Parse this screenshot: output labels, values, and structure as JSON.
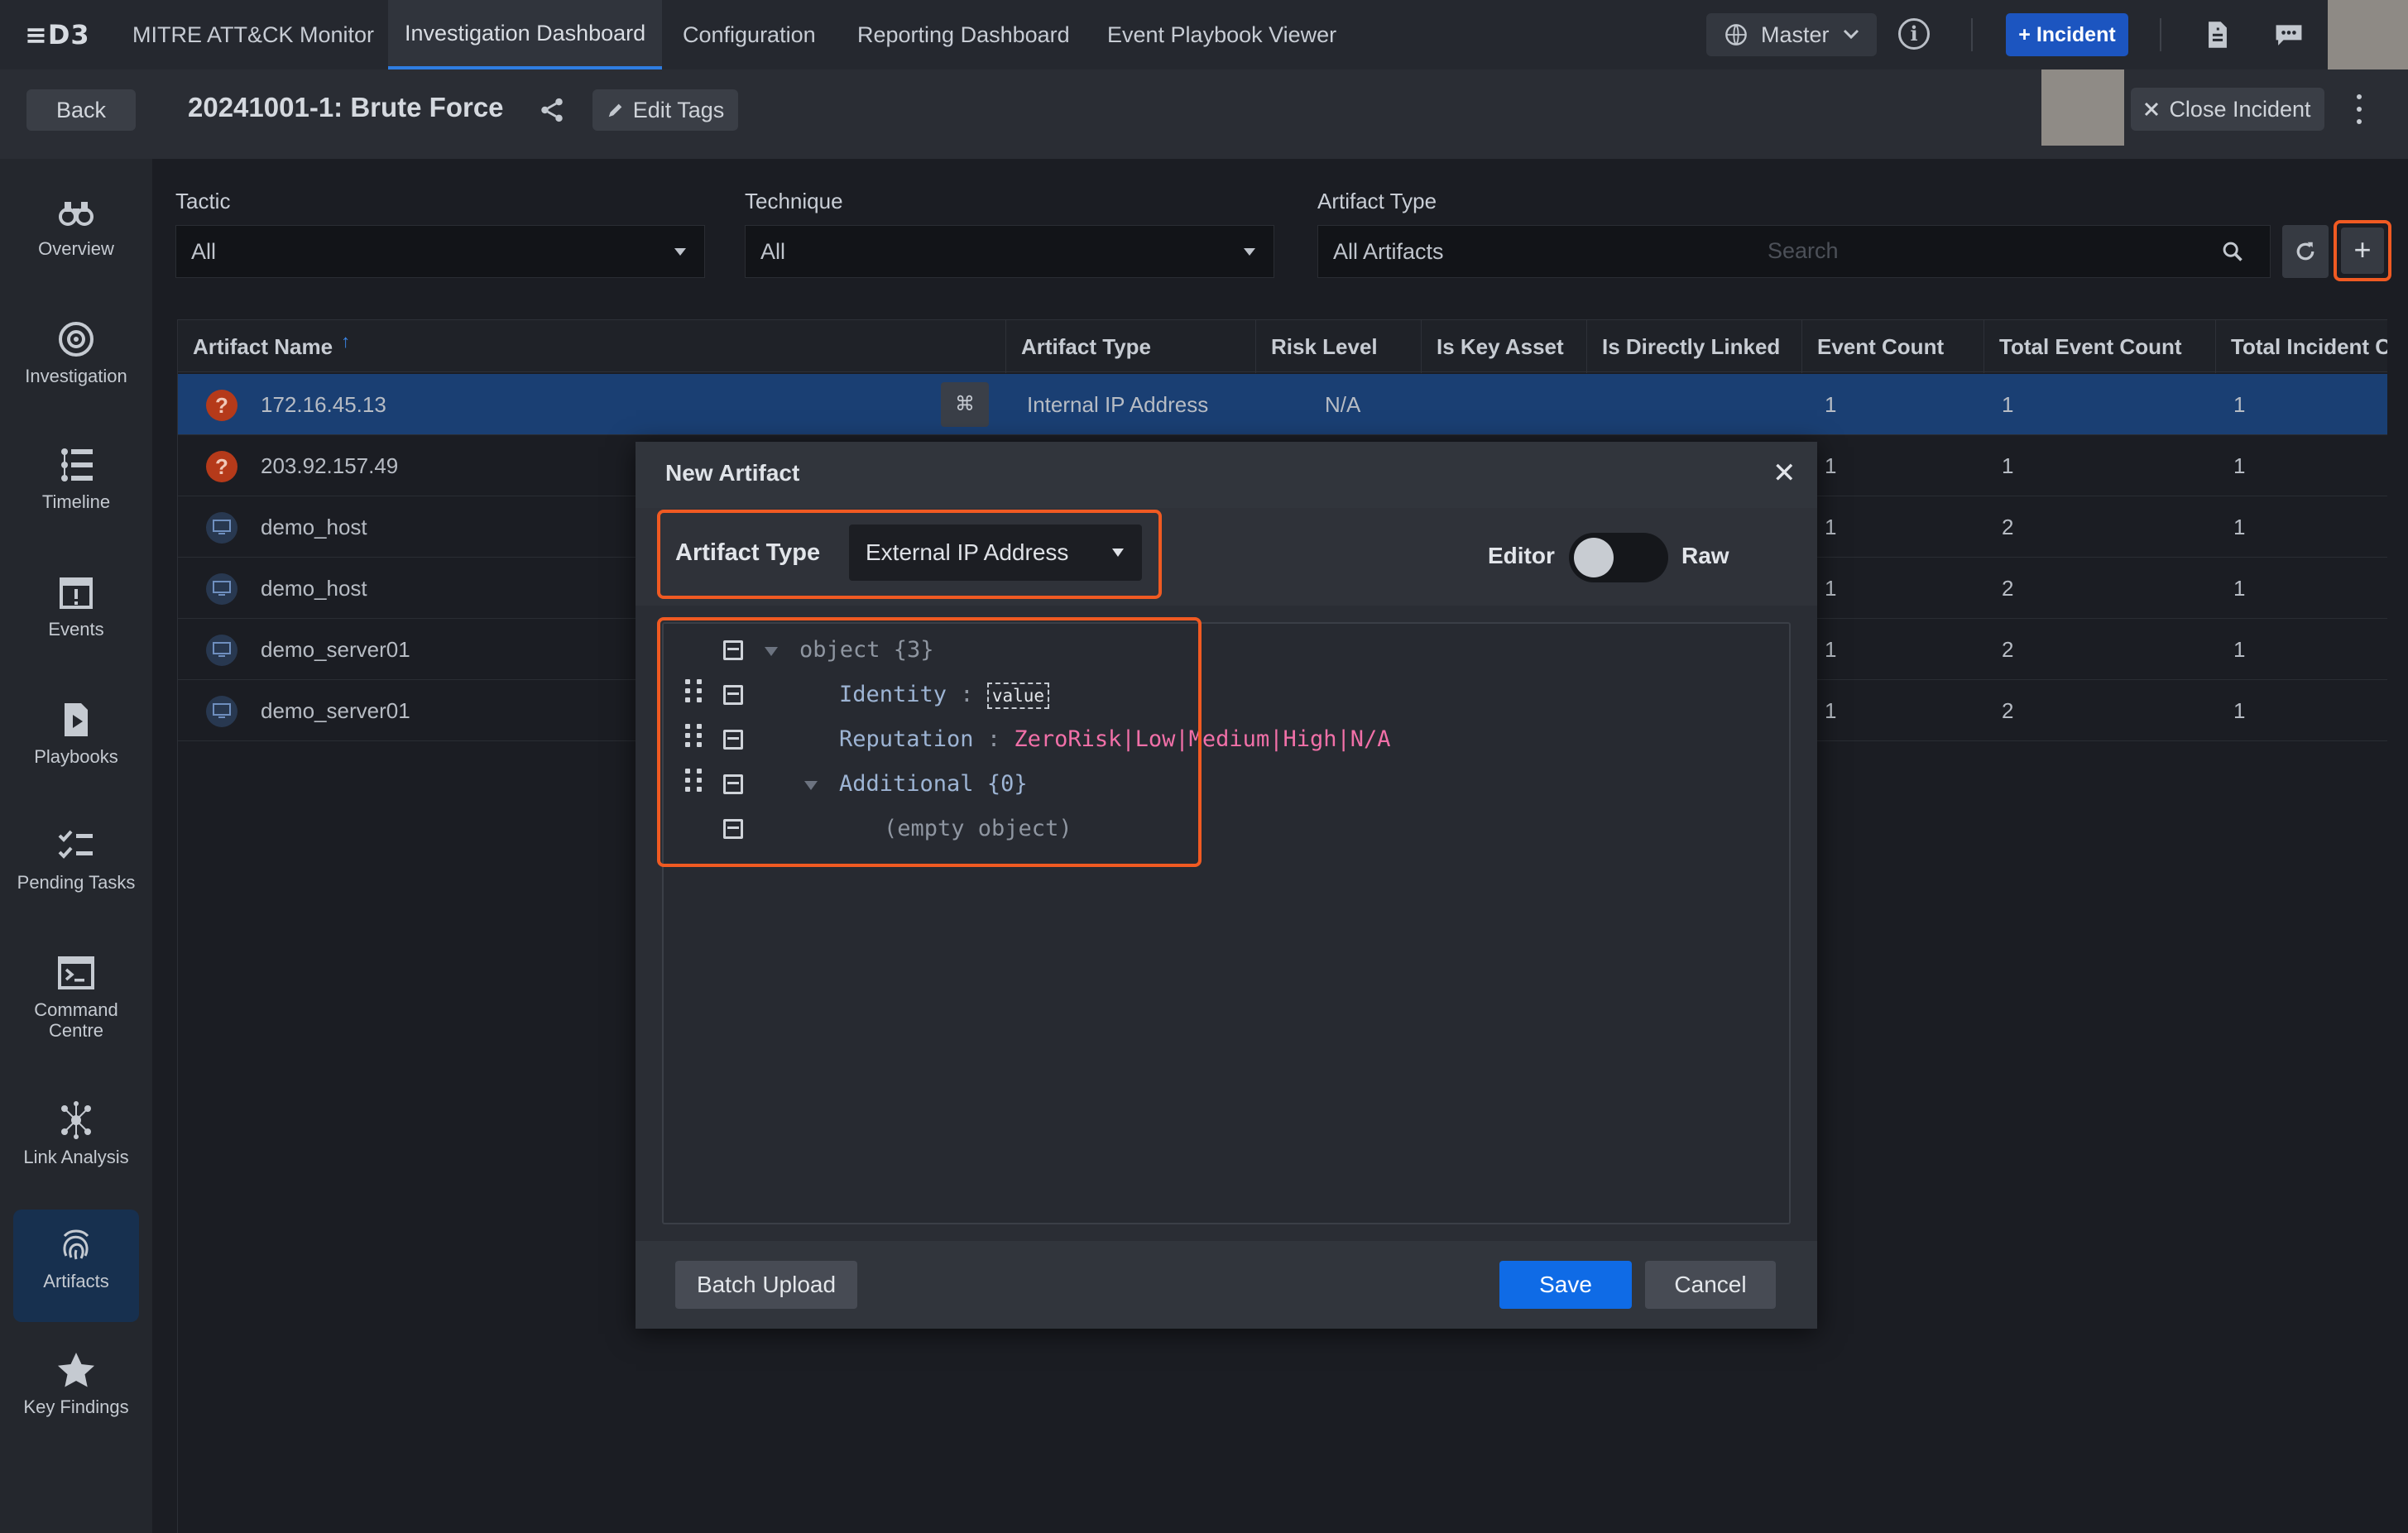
{
  "app": {
    "logo_text": "≡D3"
  },
  "nav": {
    "tabs": [
      "MITRE ATT&CK Monitor",
      "Investigation Dashboard",
      "Configuration",
      "Reporting Dashboard",
      "Event Playbook Viewer"
    ],
    "workspace_label": "Master",
    "incident_button": "+ Incident"
  },
  "subheader": {
    "back_label": "Back",
    "incident_title": "20241001-1: Brute Force",
    "edit_tags_label": "Edit Tags",
    "close_incident_label": "Close Incident"
  },
  "sidebar": {
    "items": [
      {
        "label": "Overview",
        "icon": "binoculars-icon"
      },
      {
        "label": "Investigation",
        "icon": "target-icon"
      },
      {
        "label": "Timeline",
        "icon": "timeline-icon"
      },
      {
        "label": "Events",
        "icon": "calendar-alert-icon"
      },
      {
        "label": "Playbooks",
        "icon": "playbook-icon"
      },
      {
        "label": "Pending Tasks",
        "icon": "tasks-icon"
      },
      {
        "label": "Command Centre",
        "icon": "terminal-icon"
      },
      {
        "label": "Link Analysis",
        "icon": "graph-icon"
      },
      {
        "label": "Artifacts",
        "icon": "fingerprint-icon"
      },
      {
        "label": "Key Findings",
        "icon": "star-icon"
      }
    ],
    "active": "Artifacts"
  },
  "filters": {
    "tactic": {
      "label": "Tactic",
      "value": "All"
    },
    "technique": {
      "label": "Technique",
      "value": "All"
    },
    "artifact_type": {
      "label": "Artifact Type",
      "value": "All Artifacts"
    },
    "search_placeholder": "Search"
  },
  "table": {
    "columns": [
      "Artifact Name",
      "Artifact Type",
      "Risk Level",
      "Is Key Asset",
      "Is Directly Linked",
      "Event Count",
      "Total Event Count",
      "Total Incident Co"
    ],
    "rows": [
      {
        "name": "172.16.45.13",
        "type": "Internal IP Address",
        "risk": "N/A",
        "event_count": "1",
        "total_event_count": "1",
        "total_incident_count": "1",
        "icon": "question"
      },
      {
        "name": "203.92.157.49",
        "event_count": "1",
        "total_event_count": "1",
        "total_incident_count": "1",
        "icon": "question"
      },
      {
        "name": "demo_host",
        "event_count": "1",
        "total_event_count": "2",
        "total_incident_count": "1",
        "icon": "host"
      },
      {
        "name": "demo_host",
        "event_count": "1",
        "total_event_count": "2",
        "total_incident_count": "1",
        "icon": "host"
      },
      {
        "name": "demo_server01",
        "event_count": "1",
        "total_event_count": "2",
        "total_incident_count": "1",
        "icon": "host"
      },
      {
        "name": "demo_server01",
        "event_count": "1",
        "total_event_count": "2",
        "total_incident_count": "1",
        "icon": "host"
      }
    ]
  },
  "modal": {
    "title": "New Artifact",
    "artifact_type_label": "Artifact Type",
    "artifact_type_value": "External IP Address",
    "editor_label": "Editor",
    "raw_label": "Raw",
    "tree": {
      "root": "object {3}",
      "identity_key": "Identity",
      "identity_value": "value",
      "reputation_key": "Reputation",
      "reputation_value": "ZeroRisk|Low|Medium|High|N/A",
      "additional_key": "Additional",
      "additional_meta": "{0}",
      "empty_text": "(empty object)"
    },
    "batch_upload_label": "Batch Upload",
    "save_label": "Save",
    "cancel_label": "Cancel"
  },
  "colors": {
    "accent_blue": "#0f6be6",
    "highlight_orange": "#f05a22",
    "selected_row": "#1a3f73"
  }
}
